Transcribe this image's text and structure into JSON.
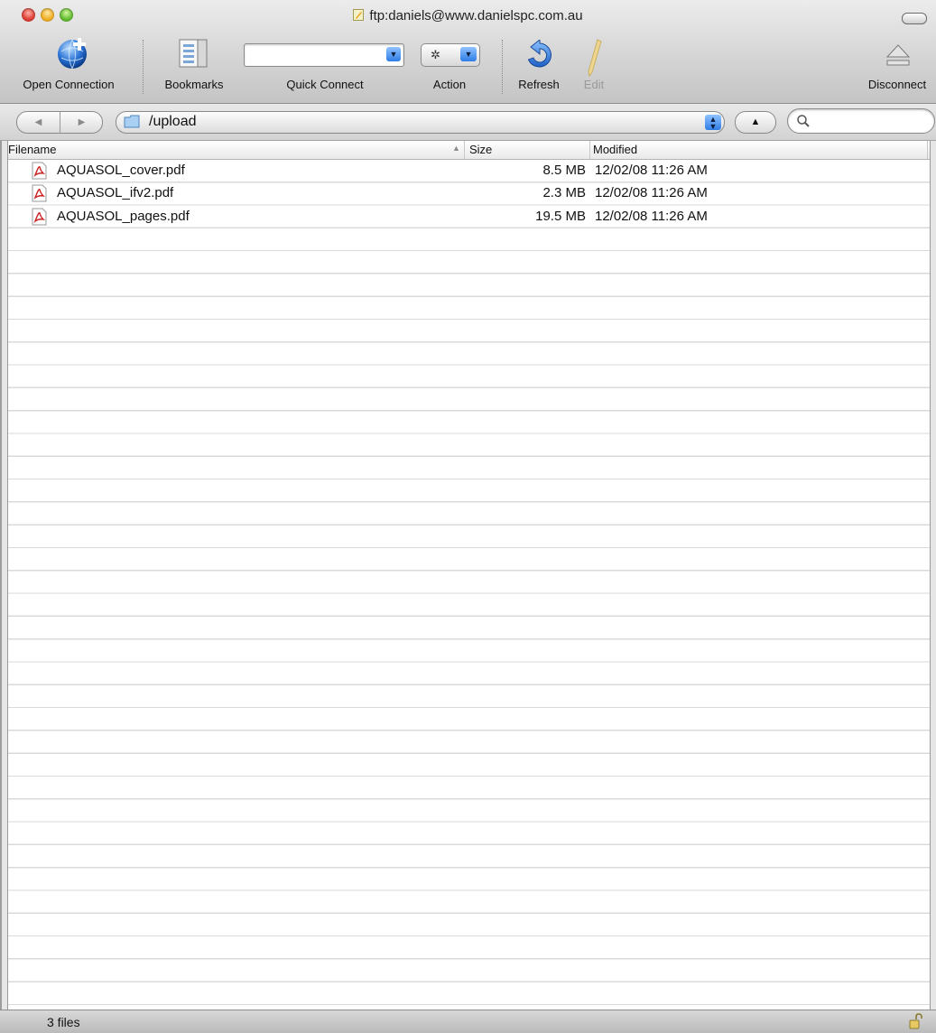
{
  "window": {
    "title": "ftp:daniels@www.danielspc.com.au"
  },
  "toolbar": {
    "open_connection": "Open Connection",
    "bookmarks": "Bookmarks",
    "quick_connect": "Quick Connect",
    "action": "Action",
    "refresh": "Refresh",
    "edit": "Edit",
    "disconnect": "Disconnect",
    "quick_connect_value": ""
  },
  "navigation": {
    "path": "/upload",
    "search_value": ""
  },
  "table": {
    "columns": {
      "filename": "Filename",
      "size": "Size",
      "modified": "Modified"
    },
    "rows": [
      {
        "name": "AQUASOL_cover.pdf",
        "size": "8.5 MB",
        "modified": "12/02/08 11:26 AM",
        "icon": "pdf-icon"
      },
      {
        "name": "AQUASOL_ifv2.pdf",
        "size": "2.3 MB",
        "modified": "12/02/08 11:26 AM",
        "icon": "pdf-icon"
      },
      {
        "name": "AQUASOL_pages.pdf",
        "size": "19.5 MB",
        "modified": "12/02/08 11:26 AM",
        "icon": "pdf-icon"
      }
    ]
  },
  "status": {
    "text": "3 files"
  },
  "colors": {
    "accent_blue": "#2f7de6",
    "row_line": "#dadada",
    "pdf_red": "#cc2020"
  }
}
